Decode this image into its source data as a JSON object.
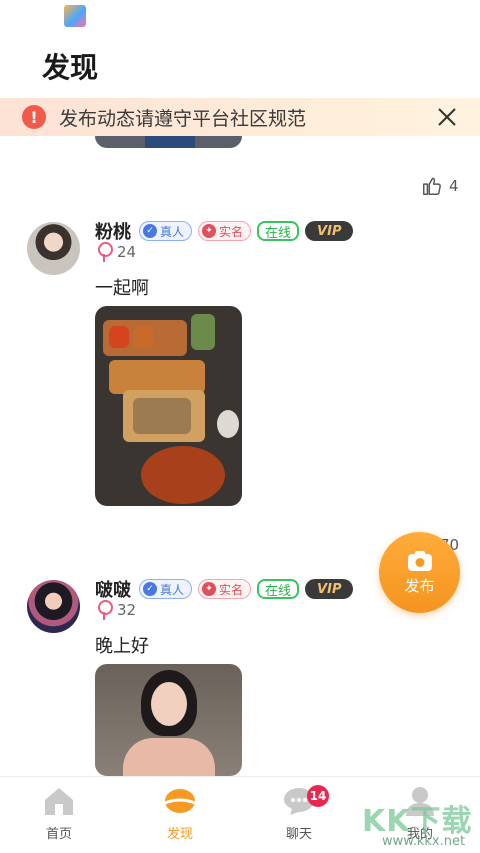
{
  "header": {
    "title": "发现"
  },
  "notice": {
    "text": "发布动态请遵守平台社区规范",
    "icon": "info-icon"
  },
  "posts": [
    {
      "likes": "4"
    },
    {
      "nickname": "粉桃",
      "badges": {
        "real": "真人",
        "name": "实名",
        "online": "在线",
        "vip": "VIP"
      },
      "age": "24",
      "text": "一起啊"
    },
    {
      "nickname": "啵啵",
      "badges": {
        "real": "真人",
        "name": "实名",
        "online": "在线",
        "vip": "VIP"
      },
      "age": "32",
      "text": "晚上好"
    }
  ],
  "partial_count": "70",
  "fab": {
    "label": "发布"
  },
  "nav": {
    "items": [
      {
        "label": "首页",
        "icon": "home-icon"
      },
      {
        "label": "发现",
        "icon": "discover-icon",
        "active": true
      },
      {
        "label": "聊天",
        "icon": "chat-icon",
        "badge": "14"
      },
      {
        "label": "我的",
        "icon": "profile-icon"
      }
    ]
  },
  "watermark": {
    "big": "KK下载",
    "small": "www.kkx.net"
  },
  "colors": {
    "accent": "#f59a23",
    "notice_bg": "#fde2d6",
    "badge_red": "#e8294f"
  }
}
